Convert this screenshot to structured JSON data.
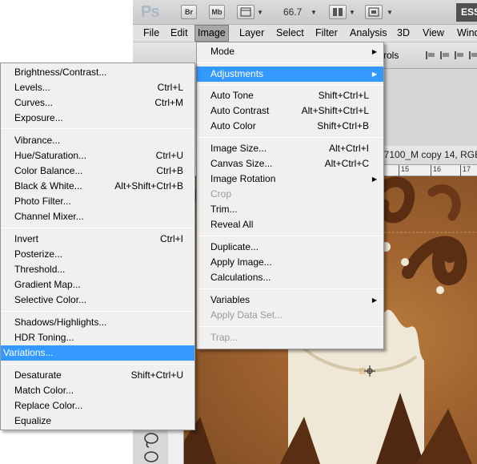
{
  "app": {
    "logo": "Ps",
    "bridge_button": "Br",
    "minibridge_button": "Mb",
    "zoom_level": "66.7",
    "workspace_label": "ESS"
  },
  "menubar": {
    "items": [
      "File",
      "Edit",
      "Image",
      "Layer",
      "Select",
      "Filter",
      "Analysis",
      "3D",
      "View",
      "Wind"
    ],
    "active": "Image"
  },
  "options_bar": {
    "controls_label": "ntrols"
  },
  "document": {
    "tab_title": "47100_M copy 14, RGB",
    "ruler_ticks": [
      "15",
      "16",
      "17"
    ]
  },
  "image_menu": {
    "items": [
      {
        "label": "Mode",
        "submenu": true
      },
      {
        "label": "Adjustments",
        "submenu": true,
        "highlighted": true
      },
      {
        "label": "Auto Tone",
        "shortcut": "Shift+Ctrl+L"
      },
      {
        "label": "Auto Contrast",
        "shortcut": "Alt+Shift+Ctrl+L"
      },
      {
        "label": "Auto Color",
        "shortcut": "Shift+Ctrl+B"
      },
      {
        "label": "Image Size...",
        "shortcut": "Alt+Ctrl+I"
      },
      {
        "label": "Canvas Size...",
        "shortcut": "Alt+Ctrl+C"
      },
      {
        "label": "Image Rotation",
        "submenu": true
      },
      {
        "label": "Crop",
        "disabled": true
      },
      {
        "label": "Trim..."
      },
      {
        "label": "Reveal All"
      },
      {
        "label": "Duplicate..."
      },
      {
        "label": "Apply Image..."
      },
      {
        "label": "Calculations..."
      },
      {
        "label": "Variables",
        "submenu": true
      },
      {
        "label": "Apply Data Set...",
        "disabled": true
      },
      {
        "label": "Trap...",
        "disabled": true
      }
    ]
  },
  "adjustments_menu": {
    "items": [
      {
        "label": "Brightness/Contrast..."
      },
      {
        "label": "Levels...",
        "shortcut": "Ctrl+L"
      },
      {
        "label": "Curves...",
        "shortcut": "Ctrl+M"
      },
      {
        "label": "Exposure..."
      },
      {
        "label": "Vibrance..."
      },
      {
        "label": "Hue/Saturation...",
        "shortcut": "Ctrl+U"
      },
      {
        "label": "Color Balance...",
        "shortcut": "Ctrl+B"
      },
      {
        "label": "Black & White...",
        "shortcut": "Alt+Shift+Ctrl+B"
      },
      {
        "label": "Photo Filter..."
      },
      {
        "label": "Channel Mixer..."
      },
      {
        "label": "Invert",
        "shortcut": "Ctrl+I"
      },
      {
        "label": "Posterize..."
      },
      {
        "label": "Threshold..."
      },
      {
        "label": "Gradient Map..."
      },
      {
        "label": "Selective Color..."
      },
      {
        "label": "Shadows/Highlights..."
      },
      {
        "label": "HDR Toning..."
      },
      {
        "label": "Variations...",
        "highlighted": true
      },
      {
        "label": "Desaturate",
        "shortcut": "Shift+Ctrl+U"
      },
      {
        "label": "Match Color..."
      },
      {
        "label": "Replace Color..."
      },
      {
        "label": "Equalize"
      }
    ]
  },
  "colors": {
    "highlight": "#3399ff",
    "menu_bg": "#f0f0f0",
    "disabled_text": "#9a9a9a",
    "canvas_brown": "#a06330",
    "chocolate": "#5a2e12",
    "milk": "#efe8d6"
  },
  "icons": [
    "move-tool-icon",
    "lasso-tool-icon",
    "crosshair-icon",
    "submenu-arrow-icon",
    "align-icon",
    "screen-mode-icon",
    "view-extras-icon"
  ]
}
